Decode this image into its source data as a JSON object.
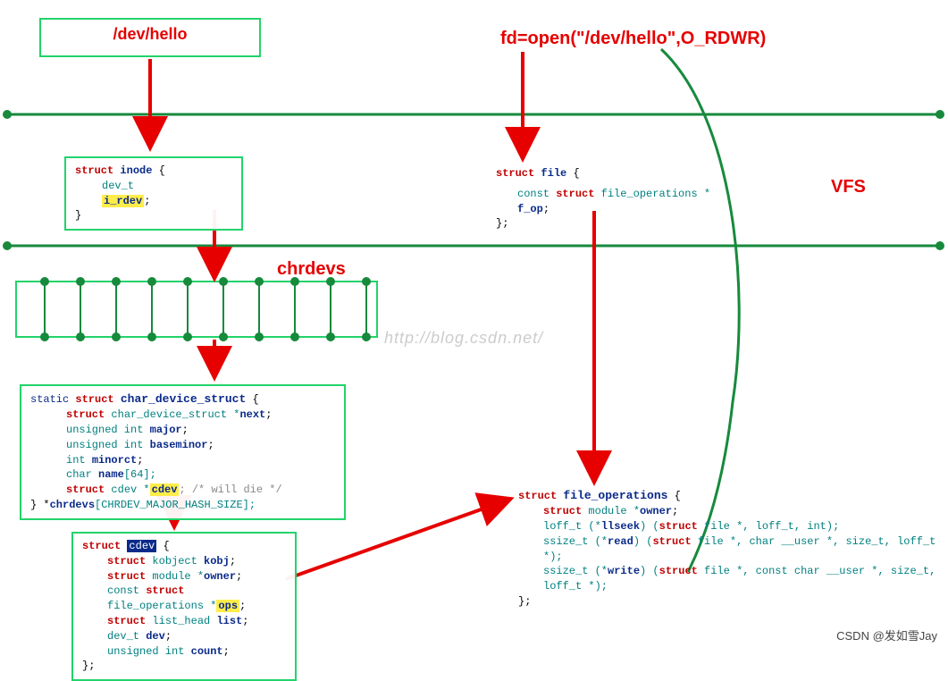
{
  "top": {
    "dev_path": "/dev/hello",
    "open_call": "fd=open(\"/dev/hello\",O_RDWR)"
  },
  "labels": {
    "vfs": "VFS",
    "chrdevs": "chrdevs"
  },
  "inode": {
    "decl": "struct",
    "name": "inode",
    "open": " {",
    "line1_type": "dev_t",
    "line1_field": "i_rdev",
    "close": "}"
  },
  "file": {
    "decl": "struct",
    "name": "file",
    "open": " {",
    "line1_a": "const ",
    "line1_b": "struct",
    "line1_c": " file_operations  *",
    "line1_field": "f_op",
    "close": "};"
  },
  "cds": {
    "line0_a": "static ",
    "line0_b": "struct",
    "line0_c": " char_device_struct",
    "line0_d": " {",
    "line1_a": "struct",
    "line1_b": " char_device_struct *",
    "line1_c": "next",
    "line2_a": "unsigned int ",
    "line2_b": "major",
    "line3_a": "unsigned int ",
    "line3_b": "baseminor",
    "line4_a": "int ",
    "line4_b": "minorct",
    "line5_a": "char ",
    "line5_b": "name",
    "line5_c": "[64];",
    "line6_a": "struct",
    "line6_b": " cdev *",
    "line6_c": "cdev",
    "line6_d": ";          /* will die */",
    "line7_a": "} *",
    "line7_b": "chrdevs",
    "line7_c": "[CHRDEV_MAJOR_HASH_SIZE];"
  },
  "cdev": {
    "line0_a": "struct",
    "line0_b": " cdev",
    "line0_c": " {",
    "line1_a": "struct",
    "line1_b": " kobject ",
    "line1_c": "kobj",
    "line2_a": "struct",
    "line2_b": " module *",
    "line2_c": "owner",
    "line3_a": "const ",
    "line3_b": "struct",
    "line3_c": " file_operations *",
    "line3_d": "ops",
    "line4_a": "struct",
    "line4_b": " list_head ",
    "line4_c": "list",
    "line5_a": "dev_t ",
    "line5_b": "dev",
    "line6_a": "unsigned int ",
    "line6_b": "count",
    "line7": "};"
  },
  "fops": {
    "line0_a": "struct",
    "line0_b": " file_operations",
    "line0_c": " {",
    "line1_a": "struct",
    "line1_b": " module *",
    "line1_c": "owner",
    "line2_a": "loff_t (*",
    "line2_b": "llseek",
    "line2_c": ") (",
    "line2_d": "struct",
    "line2_e": " file *, loff_t, int);",
    "line3_a": "ssize_t (*",
    "line3_b": "read",
    "line3_c": ") (",
    "line3_d": "struct",
    "line3_e": " file *, char __user *, size_t, loff_t *);",
    "line4_a": "ssize_t (*",
    "line4_b": "write",
    "line4_c": ") (",
    "line4_d": "struct",
    "line4_e": " file *, const char __user *, size_t, loff_t *);",
    "line5": "};"
  },
  "watermark": "http://blog.csdn.net/",
  "credit": "CSDN @发如雪Jay"
}
